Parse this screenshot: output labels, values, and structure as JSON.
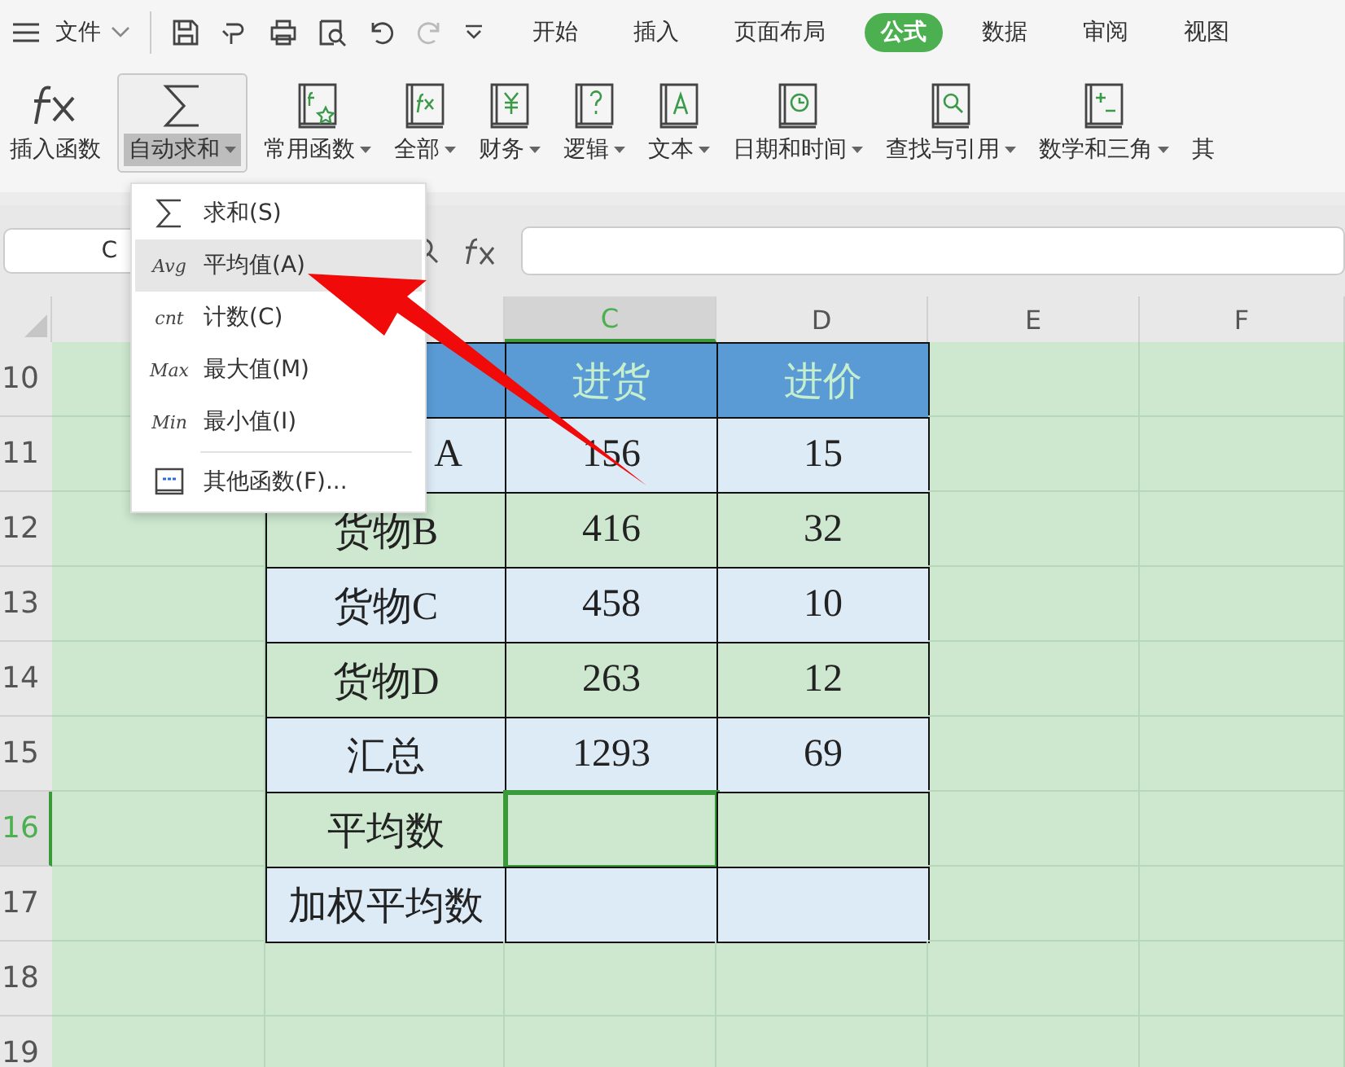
{
  "menu_bar": {
    "file": "文件",
    "tabs": [
      {
        "label": "开始",
        "selected": false
      },
      {
        "label": "插入",
        "selected": false
      },
      {
        "label": "页面布局",
        "selected": false
      },
      {
        "label": "公式",
        "selected": true
      },
      {
        "label": "数据",
        "selected": false
      },
      {
        "label": "审阅",
        "selected": false
      },
      {
        "label": "视图",
        "selected": false
      }
    ]
  },
  "ribbon": [
    {
      "label": "插入函数",
      "kind": "fx",
      "dropdown": false,
      "pressed": false
    },
    {
      "label": "自动求和",
      "kind": "sigma",
      "dropdown": true,
      "pressed": true
    },
    {
      "label": "常用函数",
      "kind": "star",
      "dropdown": true,
      "pressed": false
    },
    {
      "label": "全部",
      "kind": "fxbook",
      "dropdown": true,
      "pressed": false
    },
    {
      "label": "财务",
      "kind": "yen",
      "dropdown": true,
      "pressed": false
    },
    {
      "label": "逻辑",
      "kind": "question",
      "dropdown": true,
      "pressed": false
    },
    {
      "label": "文本",
      "kind": "letter",
      "dropdown": true,
      "pressed": false
    },
    {
      "label": "日期和时间",
      "kind": "clock",
      "dropdown": true,
      "pressed": false
    },
    {
      "label": "查找与引用",
      "kind": "magnifier",
      "dropdown": true,
      "pressed": false
    },
    {
      "label": "数学和三角",
      "kind": "plusminus",
      "dropdown": true,
      "pressed": false
    },
    {
      "label": "其",
      "kind": "none",
      "dropdown": false,
      "pressed": false
    }
  ],
  "formula_bar": {
    "name_box": "C"
  },
  "sheet": {
    "columns": [
      {
        "label": "C",
        "selected": true
      },
      {
        "label": "D",
        "selected": false
      },
      {
        "label": "E",
        "selected": false
      },
      {
        "label": "F",
        "selected": false
      }
    ],
    "rows": [
      {
        "number": "10",
        "selected": false,
        "kind": "header",
        "cells": [
          {
            "selected": false
          },
          {
            "text": "进货",
            "selected": false
          },
          {
            "text": "进价",
            "selected": false
          }
        ]
      },
      {
        "number": "11",
        "selected": false,
        "kind": "banded",
        "cells": [
          {
            "text": "A",
            "kind": "cut",
            "selected": false
          },
          {
            "text": "156",
            "selected": false
          },
          {
            "text": "15",
            "selected": false
          }
        ]
      },
      {
        "number": "12",
        "selected": false,
        "kind": "plain",
        "cells": [
          {
            "text": "货物B",
            "selected": false
          },
          {
            "text": "416",
            "selected": false
          },
          {
            "text": "32",
            "selected": false
          }
        ]
      },
      {
        "number": "13",
        "selected": false,
        "kind": "banded",
        "cells": [
          {
            "text": "货物C",
            "selected": false
          },
          {
            "text": "458",
            "selected": false
          },
          {
            "text": "10",
            "selected": false
          }
        ]
      },
      {
        "number": "14",
        "selected": false,
        "kind": "plain",
        "cells": [
          {
            "text": "货物D",
            "selected": false
          },
          {
            "text": "263",
            "selected": false
          },
          {
            "text": "12",
            "selected": false
          }
        ]
      },
      {
        "number": "15",
        "selected": false,
        "kind": "banded",
        "cells": [
          {
            "text": "汇总",
            "selected": false
          },
          {
            "text": "1293",
            "selected": false
          },
          {
            "text": "69",
            "selected": false
          }
        ]
      },
      {
        "number": "16",
        "selected": true,
        "kind": "plain",
        "cells": [
          {
            "text": "平均数",
            "selected": false
          },
          {
            "selected": true
          },
          {
            "selected": false
          }
        ]
      },
      {
        "number": "17",
        "selected": false,
        "kind": "banded",
        "cells": [
          {
            "text": "加权平均数",
            "selected": false
          },
          {
            "selected": false
          },
          {
            "selected": false
          }
        ]
      },
      {
        "number": "18",
        "selected": false,
        "kind": "empty"
      },
      {
        "number": "19",
        "selected": false,
        "kind": "empty"
      }
    ]
  },
  "dropdown": {
    "items": [
      {
        "kind": "sum",
        "label": "求和(S)",
        "selected": false,
        "separator_before": false
      },
      {
        "kind": "abbrev",
        "icon_text": "Avg",
        "label": "平均值(A)",
        "selected": true,
        "separator_before": false
      },
      {
        "kind": "abbrev",
        "icon_text": "cnt",
        "label": "计数(C)",
        "selected": false,
        "separator_before": false
      },
      {
        "kind": "abbrev",
        "icon_text": "Max",
        "label": "最大值(M)",
        "selected": false,
        "separator_before": false
      },
      {
        "kind": "abbrev",
        "icon_text": "Min",
        "label": "最小值(I)",
        "selected": false,
        "separator_before": false
      },
      {
        "kind": "book",
        "label": "其他函数(F)...",
        "selected": false,
        "separator_before": true
      }
    ]
  }
}
